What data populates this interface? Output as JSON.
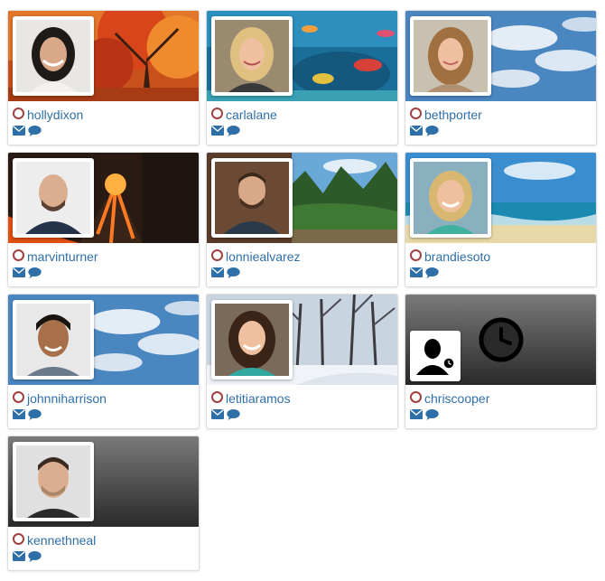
{
  "colors": {
    "link": "#2f6fa7",
    "status_offline": "#a04040",
    "icon": "#2f6fa7"
  },
  "profiles": [
    {
      "username": "hollydixon",
      "cover": "autumn-tree",
      "status": "offline"
    },
    {
      "username": "carlalane",
      "cover": "coral-reef",
      "status": "offline"
    },
    {
      "username": "bethporter",
      "cover": "sky-clouds",
      "status": "offline"
    },
    {
      "username": "marvinturner",
      "cover": "volcano",
      "status": "offline"
    },
    {
      "username": "lonniealvarez",
      "cover": "forest-river",
      "status": "offline"
    },
    {
      "username": "brandiesoto",
      "cover": "beach",
      "status": "offline"
    },
    {
      "username": "johnniharrison",
      "cover": "sky-clouds",
      "status": "offline"
    },
    {
      "username": "letitiaramos",
      "cover": "snowy-trees",
      "status": "offline"
    },
    {
      "username": "chriscooper",
      "cover": "dark-clock",
      "status": "offline",
      "default_avatar": true
    },
    {
      "username": "kennethneal",
      "cover": "dark-gradient",
      "status": "offline"
    }
  ],
  "icons": {
    "email": "envelope-icon",
    "message": "speech-bubble-icon",
    "status": "status-circle-icon"
  }
}
